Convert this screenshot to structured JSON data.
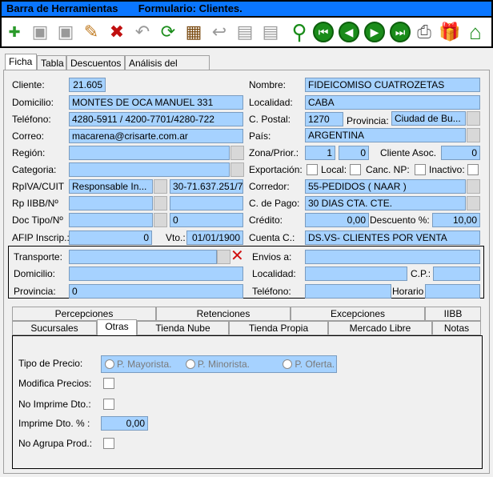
{
  "window": {
    "title": "Barra de Herramientas       Formulario: Clientes."
  },
  "toolbar": {
    "icons": [
      "add-icon",
      "save-icon",
      "save-disabled-icon",
      "edit-icon",
      "delete-icon",
      "undo-icon",
      "refresh-icon",
      "film-icon",
      "back-arrow-icon",
      "grid-icon",
      "grid-icon",
      "search-icon",
      "first-icon",
      "prev-icon",
      "next-icon",
      "last-icon",
      "printer-icon",
      "gift-icon",
      "home-icon"
    ],
    "glyphs": {
      "add": "✚",
      "save": "▣",
      "edit": "✎",
      "delete": "✖",
      "undo": "↶",
      "refresh": "⟳",
      "film": "▦",
      "back": "↩",
      "grid": "▤",
      "search": "⚲",
      "first": "⏮",
      "prev": "◀",
      "next": "▶",
      "last": "⏭",
      "printer": "⎙",
      "gift": "🎁",
      "home": "⌂"
    }
  },
  "tabs": [
    "Ficha",
    "Tabla",
    "Descuentos",
    "Análisis del Cliente"
  ],
  "labels": {
    "cliente": "Cliente:",
    "nombre": "Nombre:",
    "domicilio": "Domicilio:",
    "localidad": "Localidad:",
    "telefono": "Teléfono:",
    "cpostal": "C. Postal:",
    "provincia": "Provincia:",
    "correo": "Correo:",
    "pais": "País:",
    "region": "Región:",
    "zona": "Zona/Prior.:",
    "cliente_asoc": "Cliente Asoc.",
    "categoria": "Categoria:",
    "exportacion": "Exportación:",
    "local": "Local:",
    "canc_np": "Canc. NP:",
    "inactivo": "Inactivo:",
    "rpiva": "RpIVA/CUIT",
    "corredor": "Corredor:",
    "rp_iibb": "Rp IIBB/Nº",
    "cpago": "C. de Pago:",
    "doc_tipo": "Doc Tipo/Nº",
    "credito": "Crédito:",
    "descuento": "Descuento %:",
    "afip": "AFIP Inscrip.:",
    "vto": "Vto.:",
    "cuenta": "Cuenta C.:",
    "transporte": "Transporte:",
    "envios": "Envios a:",
    "t_domicilio": "Domicilio:",
    "t_localidad": "Localidad:",
    "cp": "C.P.:",
    "t_provincia": "Provincia:",
    "t_telefono": "Teléfono:",
    "horario": "Horario"
  },
  "values": {
    "cliente": "21.605",
    "nombre": "FIDEICOMISO CUATROZETAS",
    "domicilio": "MONTES DE OCA MANUEL 331",
    "localidad": "CABA",
    "telefono": "4280-5911 / 4200-7701/4280-722",
    "cpostal": "1270",
    "provincia": "Ciudad de Bu...",
    "correo": "macarena@crisarte.com.ar",
    "pais": "ARGENTINA",
    "zona": "1",
    "prior": "0",
    "cliente_asoc": "0",
    "rpiva": "Responsable In...",
    "cuit": "30-71.637.251/7",
    "corredor": "55-PEDIDOS ( NAAR )",
    "cpago": "30 DIAS CTA. CTE.",
    "doc_nro": "0",
    "credito": "0,00",
    "descuento": "10,00",
    "afip": "0",
    "vto": "01/01/1900",
    "cuenta": "DS.VS- CLIENTES POR VENTA",
    "t_provincia": "0"
  },
  "subtabs_row1": [
    "Percepciones",
    "Retenciones",
    "Excepciones",
    "IIBB"
  ],
  "subtabs_row2": [
    "Sucursales",
    "Otras",
    "Tienda Nube",
    "Tienda Propia",
    "Mercado Libre",
    "Notas"
  ],
  "otras": {
    "tipo_precio": "Tipo de Precio:",
    "opciones": [
      "P. Mayorista.",
      "P. Minorista.",
      "P. Oferta."
    ],
    "modifica": "Modifica Precios:",
    "no_imprime": "No Imprime Dto.:",
    "imprime_pct": "Imprime Dto. % :",
    "imprime_val": "0,00",
    "no_agrupa": "No Agrupa Prod.:"
  }
}
